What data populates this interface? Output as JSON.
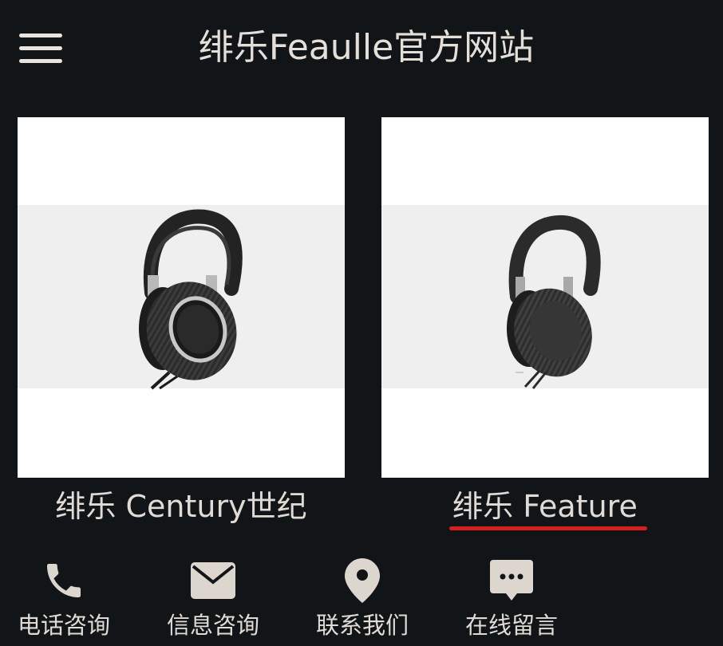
{
  "header": {
    "title": "绯乐Feaulle官方网站",
    "menu_icon": "hamburger-menu-icon"
  },
  "products": [
    {
      "name": "绯乐 Century世纪",
      "image": "headphones-century-photo"
    },
    {
      "name": "绯乐 Feature",
      "image": "headphones-feature-photo",
      "underline_color": "#d81e1e"
    }
  ],
  "bottom_nav": [
    {
      "label": "电话咨询",
      "icon": "phone-icon"
    },
    {
      "label": "信息咨询",
      "icon": "mail-icon"
    },
    {
      "label": "联系我们",
      "icon": "location-pin-icon"
    },
    {
      "label": "在线留言",
      "icon": "chat-bubble-icon"
    }
  ],
  "colors": {
    "background": "#121517",
    "text": "#e0dbd4",
    "accent": "#d81e1e"
  }
}
